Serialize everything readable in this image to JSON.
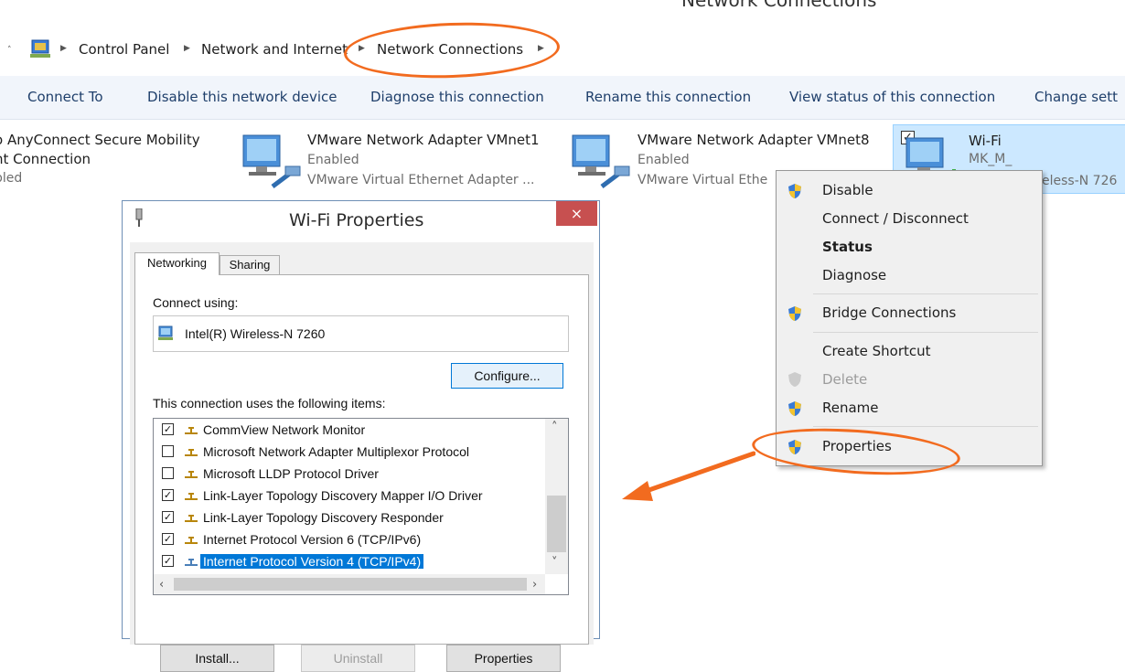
{
  "window": {
    "title": "Network Connections"
  },
  "address": {
    "crumbs": [
      "Control Panel",
      "Network and Internet",
      "Network Connections"
    ]
  },
  "commands": [
    "Connect To",
    "Disable this network device",
    "Diagnose this connection",
    "Rename this connection",
    "View status of this connection",
    "Change sett"
  ],
  "connections": [
    {
      "lines": [
        "o AnyConnect Secure Mobility",
        "nt Connection",
        "bled"
      ]
    },
    {
      "name": "VMware Network Adapter VMnet1",
      "status": "Enabled",
      "device": "VMware Virtual Ethernet Adapter ..."
    },
    {
      "name": "VMware Network Adapter VMnet8",
      "status": "Enabled",
      "device": "VMware Virtual Ethe"
    },
    {
      "name": "Wi-Fi",
      "status": "MK_M_",
      "device": "eless-N 726"
    }
  ],
  "context_menu": {
    "items": [
      {
        "label": "Disable",
        "shield": true,
        "bold": false,
        "disabled": false
      },
      {
        "label": "Connect / Disconnect",
        "shield": false,
        "bold": false,
        "disabled": false
      },
      {
        "label": "Status",
        "shield": false,
        "bold": true,
        "disabled": false
      },
      {
        "label": "Diagnose",
        "shield": false,
        "bold": false,
        "disabled": false
      },
      {
        "label": "Bridge Connections",
        "shield": true,
        "bold": false,
        "disabled": false
      },
      {
        "label": "Create Shortcut",
        "shield": false,
        "bold": false,
        "disabled": false
      },
      {
        "label": "Delete",
        "shield": true,
        "bold": false,
        "disabled": true
      },
      {
        "label": "Rename",
        "shield": true,
        "bold": false,
        "disabled": false
      },
      {
        "label": "Properties",
        "shield": true,
        "bold": false,
        "disabled": false
      }
    ]
  },
  "dialog": {
    "title": "Wi-Fi Properties",
    "close": "×",
    "tabs": [
      "Networking",
      "Sharing"
    ],
    "connect_using_label": "Connect using:",
    "adapter": "Intel(R) Wireless-N 7260",
    "configure": "Configure...",
    "items_label": "This connection uses the following items:",
    "items": [
      {
        "label": "CommView Network Monitor",
        "checked": true,
        "selected": false
      },
      {
        "label": "Microsoft Network Adapter Multiplexor Protocol",
        "checked": false,
        "selected": false
      },
      {
        "label": "Microsoft LLDP Protocol Driver",
        "checked": false,
        "selected": false
      },
      {
        "label": "Link-Layer Topology Discovery Mapper I/O Driver",
        "checked": true,
        "selected": false
      },
      {
        "label": "Link-Layer Topology Discovery Responder",
        "checked": true,
        "selected": false
      },
      {
        "label": "Internet Protocol Version 6 (TCP/IPv6)",
        "checked": true,
        "selected": false
      },
      {
        "label": "Internet Protocol Version 4 (TCP/IPv4)",
        "checked": true,
        "selected": true
      }
    ],
    "buttons": {
      "install": "Install...",
      "uninstall": "Uninstall",
      "properties": "Properties"
    }
  },
  "colors": {
    "annotation": "#f26b1f",
    "selection": "#0078d7",
    "command_text": "#1f3f6b"
  }
}
